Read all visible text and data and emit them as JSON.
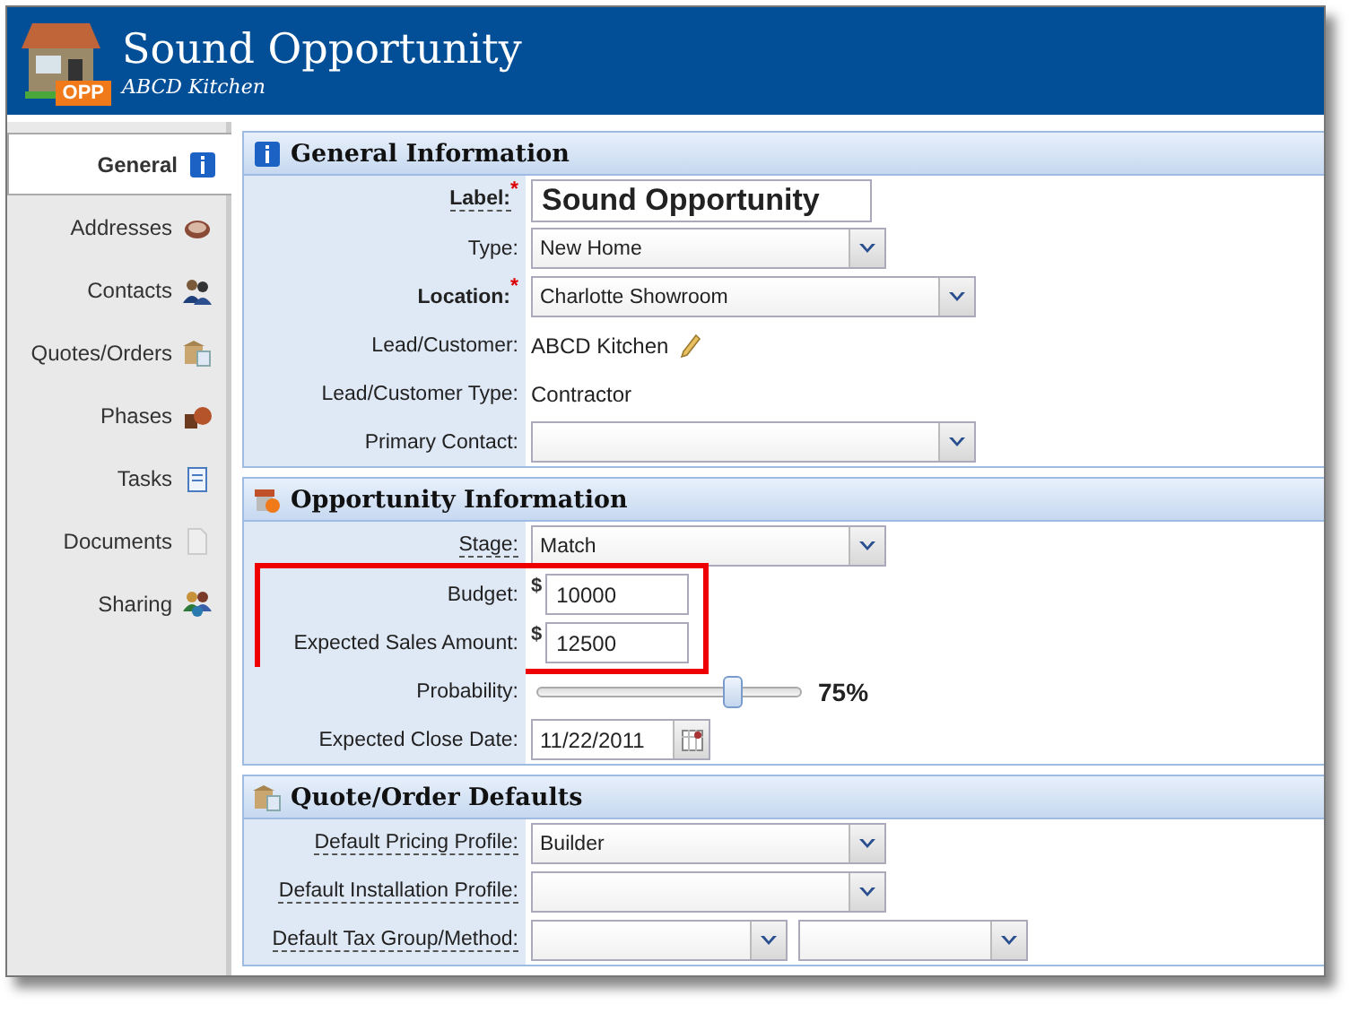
{
  "header": {
    "badge": "OPP",
    "title": "Sound Opportunity",
    "subtitle": "ABCD Kitchen"
  },
  "sidebar": {
    "items": [
      {
        "label": "General",
        "selected": true
      },
      {
        "label": "Addresses",
        "selected": false
      },
      {
        "label": "Contacts",
        "selected": false
      },
      {
        "label": "Quotes/Orders",
        "selected": false
      },
      {
        "label": "Phases",
        "selected": false
      },
      {
        "label": "Tasks",
        "selected": false
      },
      {
        "label": "Documents",
        "selected": false
      },
      {
        "label": "Sharing",
        "selected": false
      }
    ]
  },
  "sections": [
    {
      "title": "General Information",
      "rows": [
        {
          "label": "Label:",
          "marker": "*",
          "help": true,
          "kind": "bigtext",
          "value": "Sound Opportunity"
        },
        {
          "label": "Type:",
          "help": false,
          "kind": "select",
          "value": "New Home"
        },
        {
          "label": "Location:",
          "marker": "*",
          "help": false,
          "kind": "longselect",
          "value": "Charlotte Showroom"
        },
        {
          "label": "Lead/Customer:",
          "help": false,
          "kind": "text",
          "editable": true,
          "value": "ABCD Kitchen"
        },
        {
          "label": "Lead/Customer Type:",
          "help": false,
          "kind": "text",
          "editable": false,
          "value": "Contractor"
        },
        {
          "label": "Primary Contact:",
          "help": false,
          "kind": "longselect"
        }
      ]
    },
    {
      "title": "Opportunity Information",
      "rows": [
        {
          "label": "Stage:",
          "help": true,
          "kind": "select",
          "value": "Match"
        },
        {
          "label": "Budget:",
          "help": false,
          "kind": "money",
          "currency": "$",
          "value": "10000",
          "highlighted": true
        },
        {
          "label": "Expected Sales Amount:",
          "help": false,
          "kind": "money",
          "currency": "$",
          "value": "12500",
          "highlighted": true
        },
        {
          "label": "Probability:",
          "help": false,
          "kind": "slider",
          "level": 0.75,
          "reading": "75%"
        },
        {
          "label": "Expected Close Date:",
          "help": false,
          "kind": "date",
          "value": "11/22/2011"
        }
      ]
    },
    {
      "title": "Quote/Order Defaults",
      "rows": [
        {
          "label": "Default Pricing Profile:",
          "help": true,
          "kind": "select",
          "value": "Builder"
        },
        {
          "label": "Default Installation Profile:",
          "help": true,
          "kind": "select"
        },
        {
          "label": "Default Tax Group/Method:",
          "help": true,
          "kind": "doubleselect"
        }
      ]
    }
  ]
}
